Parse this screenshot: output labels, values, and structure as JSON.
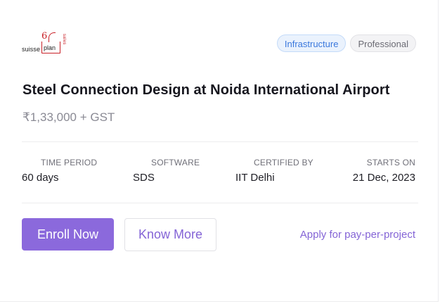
{
  "logo": {
    "word_left": "suisse",
    "word_box": "plan",
    "digit": "6",
    "vertical_text": "sales",
    "brand_red": "#c82027"
  },
  "tags": [
    {
      "label": "Infrastructure"
    },
    {
      "label": "Professional"
    }
  ],
  "course": {
    "title": "Steel Connection Design at Noida International Airport",
    "price": "₹1,33,000 + GST"
  },
  "stats": [
    {
      "label": "TIME PERIOD",
      "value": "60 days"
    },
    {
      "label": "SOFTWARE",
      "value": "SDS"
    },
    {
      "label": "CERTIFIED BY",
      "value": "IIT Delhi"
    },
    {
      "label": "STARTS ON",
      "value": "21 Dec, 2023"
    }
  ],
  "actions": {
    "enroll_label": "Enroll Now",
    "know_more_label": "Know More",
    "apply_label": "Apply for pay-per-project"
  },
  "colors": {
    "accent": "#8b69dc",
    "tag_blue": "#3a78dd"
  }
}
